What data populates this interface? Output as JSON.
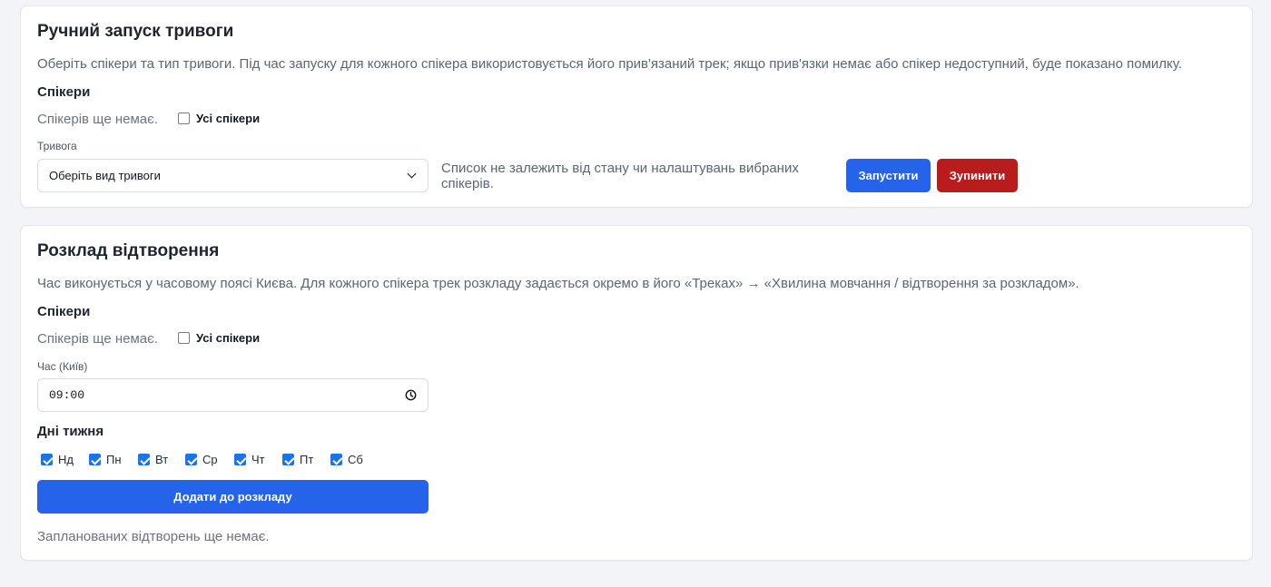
{
  "manual": {
    "title": "Ручний запуск тривоги",
    "description": "Оберіть спікери та тип тривоги. Під час запуску для кожного спікера використовується його прив'язаний трек; якщо прив'язки немає або спікер недоступний, буде показано помилку.",
    "speakers_heading": "Спікери",
    "no_speakers": "Спікерів ще немає.",
    "all_speakers_label": "Усі спікери",
    "all_speakers_checked": false,
    "alarm_label": "Тривога",
    "alarm_select_value": "Оберіть вид тривоги",
    "hint": "Список не залежить від стану чи налаштувань вибраних спікерів.",
    "start_button": "Запустити",
    "stop_button": "Зупинити"
  },
  "schedule": {
    "title": "Розклад відтворення",
    "description": "Час виконується у часовому поясі Києва. Для кожного спікера трек розкладу задається окремо в його «Треках» → «Хвилина мовчання / відтворення за розкладом».",
    "speakers_heading": "Спікери",
    "no_speakers": "Спікерів ще немає.",
    "all_speakers_label": "Усі спікери",
    "all_speakers_checked": false,
    "time_label": "Час (Київ)",
    "time_value": "09:00",
    "days_heading": "Дні тижня",
    "days": [
      {
        "label": "Нд",
        "checked": true
      },
      {
        "label": "Пн",
        "checked": true
      },
      {
        "label": "Вт",
        "checked": true
      },
      {
        "label": "Ср",
        "checked": true
      },
      {
        "label": "Чт",
        "checked": true
      },
      {
        "label": "Пт",
        "checked": true
      },
      {
        "label": "Сб",
        "checked": true
      }
    ],
    "add_button": "Додати до розкладу",
    "empty_text": "Запланованих відтворень ще немає."
  },
  "colors": {
    "primary": "#2563eb",
    "danger": "#b91c1c",
    "checkbox_checked": "#1a73e8",
    "background": "#f3f4f8"
  },
  "icons": {
    "select_arrow": "chevron-down-icon",
    "time_picker": "clock-icon"
  }
}
